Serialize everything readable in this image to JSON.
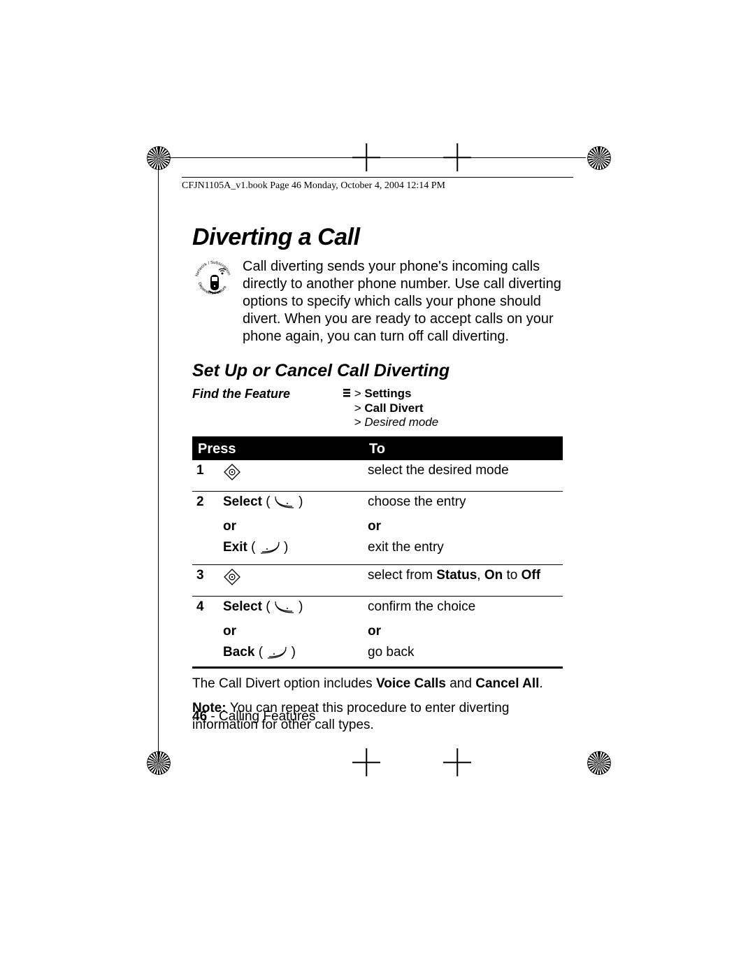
{
  "header": {
    "runhead": "CFJN1105A_v1.book  Page 46  Monday, October 4, 2004  12:14 PM"
  },
  "section": {
    "title": "Diverting a Call",
    "intro": "Call diverting sends your phone's incoming calls directly to another phone number. Use call diverting options to specify which calls your phone should divert. When you are ready to accept calls on your phone again, you can turn off call diverting.",
    "icon_label": "Network/Subscription Dependent Feature"
  },
  "subsection": {
    "title": "Set Up or Cancel Call Diverting"
  },
  "find": {
    "label": "Find the Feature",
    "path1a": "> ",
    "path1b": "Settings",
    "path2a": "> ",
    "path2b": "Call Divert",
    "path3a": "> ",
    "path3b": "Desired mode"
  },
  "table": {
    "h_press": "Press",
    "h_to": "To",
    "rows": [
      {
        "n": "1",
        "press_type": "nav",
        "to": "select the desired mode"
      },
      {
        "n": "2",
        "press_type": "select_or_exit",
        "select": "Select",
        "or": "or",
        "exit": "Exit",
        "to1": "choose the entry",
        "to_or": "or",
        "to2": "exit the entry"
      },
      {
        "n": "3",
        "press_type": "nav",
        "to_pre": "select from ",
        "to_b1": "Status",
        "to_mid": ", ",
        "to_b2": "On",
        "to_mid2": " to ",
        "to_b3": "Off"
      },
      {
        "n": "4",
        "press_type": "select_or_back",
        "select": "Select",
        "or": "or",
        "back": "Back",
        "to1": "confirm the choice",
        "to_or": "or",
        "to2": "go back"
      }
    ]
  },
  "after": {
    "p1a": "The Call Divert option includes ",
    "p1b": "Voice Calls",
    "p1c": " and ",
    "p1d": "Cancel All",
    "p1e": ".",
    "p2a": "Note: ",
    "p2b": "You can repeat this procedure to enter diverting information for other call types."
  },
  "footer": {
    "page": "46",
    "sep": " - ",
    "name": "Calling Features"
  }
}
